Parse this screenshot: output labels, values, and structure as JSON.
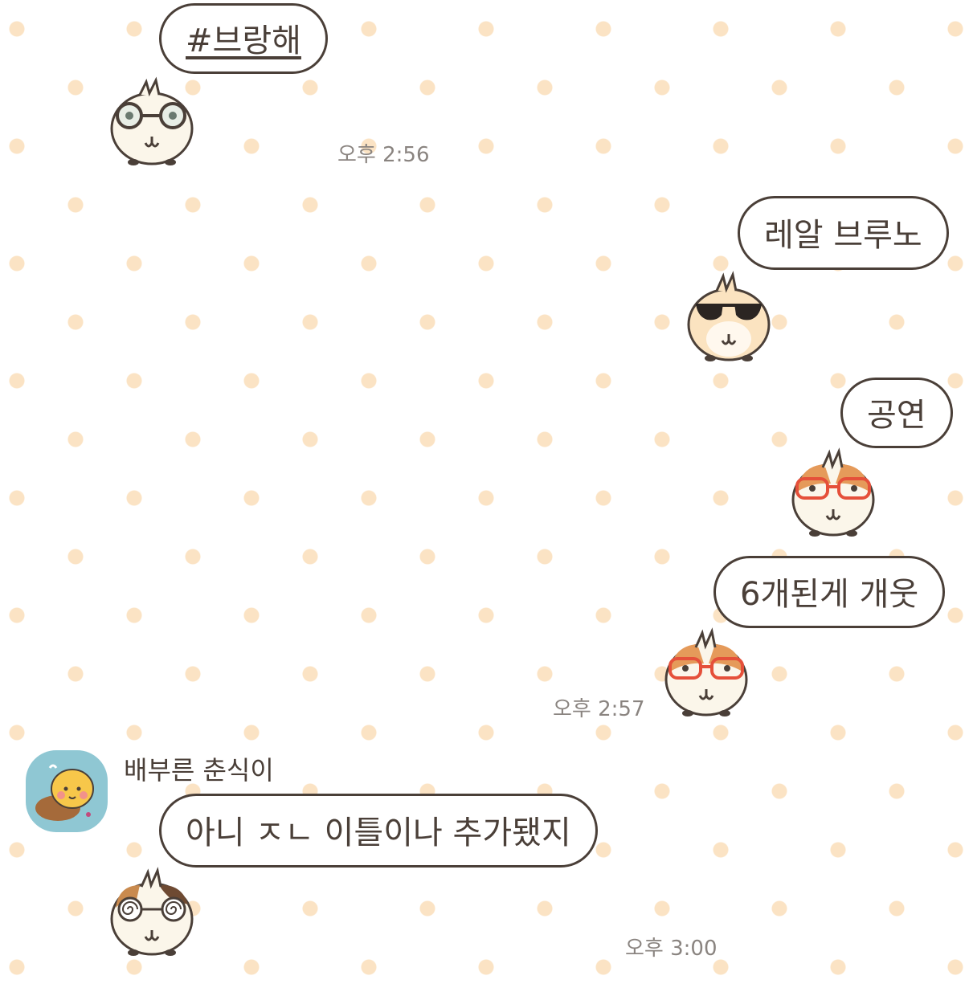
{
  "messages": [
    {
      "text": "#브랑해",
      "side": "left",
      "sticker": "guinea-pig-round-glasses-icon"
    },
    {
      "text": "레알 브루노",
      "side": "right",
      "sticker": "guinea-pig-sunglasses-icon"
    },
    {
      "text": "공연",
      "side": "right",
      "sticker": "guinea-pig-red-glasses-icon"
    },
    {
      "text": "6개된게 개웃",
      "side": "right",
      "sticker": "guinea-pig-red-glasses-icon"
    },
    {
      "text": "아니 ㅈㄴ 이틀이나 추가됐지",
      "side": "left",
      "sticker": "guinea-pig-spiral-glasses-icon"
    }
  ],
  "timestamps": {
    "t1": "오후 2:56",
    "t2": "오후 2:57",
    "t3": "오후 3:00"
  },
  "sender": {
    "name": "배부른 춘식이",
    "avatar": "chunsik-avatar-icon"
  },
  "colors": {
    "dot": "#fbe3c4",
    "bubble_border": "#4a3f38",
    "text": "#4a3f38",
    "timestamp": "#8a8480",
    "avatar_bg": "#8fc7d3"
  }
}
